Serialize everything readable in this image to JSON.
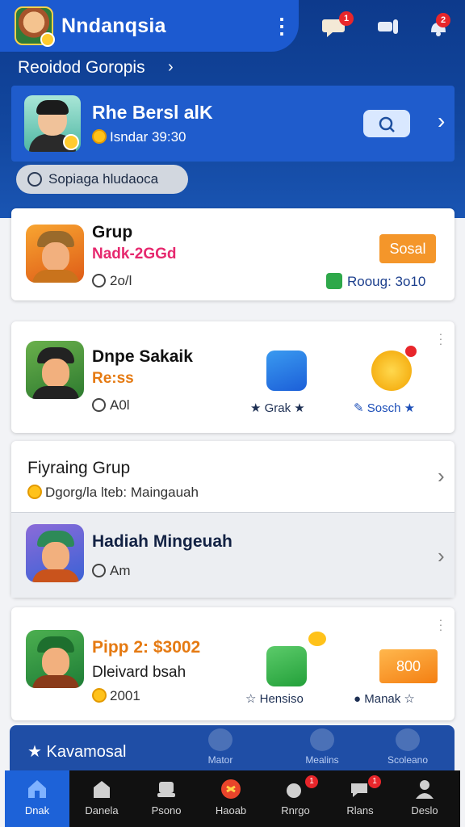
{
  "header": {
    "app_title": "Nndanqsia",
    "section_link": "Reoidod Goropis",
    "notification_badge": "1",
    "message_badge": "2"
  },
  "profile": {
    "name": "Rhe Bersl alK",
    "subtitle": "Isndar 39:30"
  },
  "chip": {
    "label": "Sopiaga hludaoca"
  },
  "cards": [
    {
      "title": "Grup",
      "line": "Nadk-2GGd",
      "time": "2o/l",
      "button": "Sosal",
      "status": "Rooug: 3o10"
    },
    {
      "title": "Dnpe Sakaik",
      "line": "Re:ss",
      "time": "A0l",
      "tile1_label": "Grak",
      "tile2_label": "Sosch"
    },
    {
      "title": "Fiyraing Grup",
      "line": "Dgorg/la lteb: Maingauah"
    },
    {
      "title": "Hadiah Mingeuah",
      "time": "Am"
    },
    {
      "title": "Pipp 2: $3002",
      "line": "Dleivard bsah",
      "time": "2001",
      "badge_value": "800",
      "tile1_label": "Hensiso",
      "tile2_label": "Manak"
    }
  ],
  "promo": {
    "label": "Kavamosal",
    "tabs": [
      "Mator",
      "Mealins",
      "Scoleano"
    ]
  },
  "tabbar": {
    "tabs": [
      "Dnak",
      "Danela",
      "Psono",
      "Haoab",
      "Rnrgo",
      "Rlans",
      "Deslo"
    ],
    "active_index": 0,
    "badges": [
      "1",
      "1"
    ]
  },
  "colors": {
    "header_blue": "#12479f",
    "accent_blue": "#1d62d8",
    "orange": "#f4962a",
    "green": "#2ea84a",
    "coin": "#ffc21a"
  }
}
